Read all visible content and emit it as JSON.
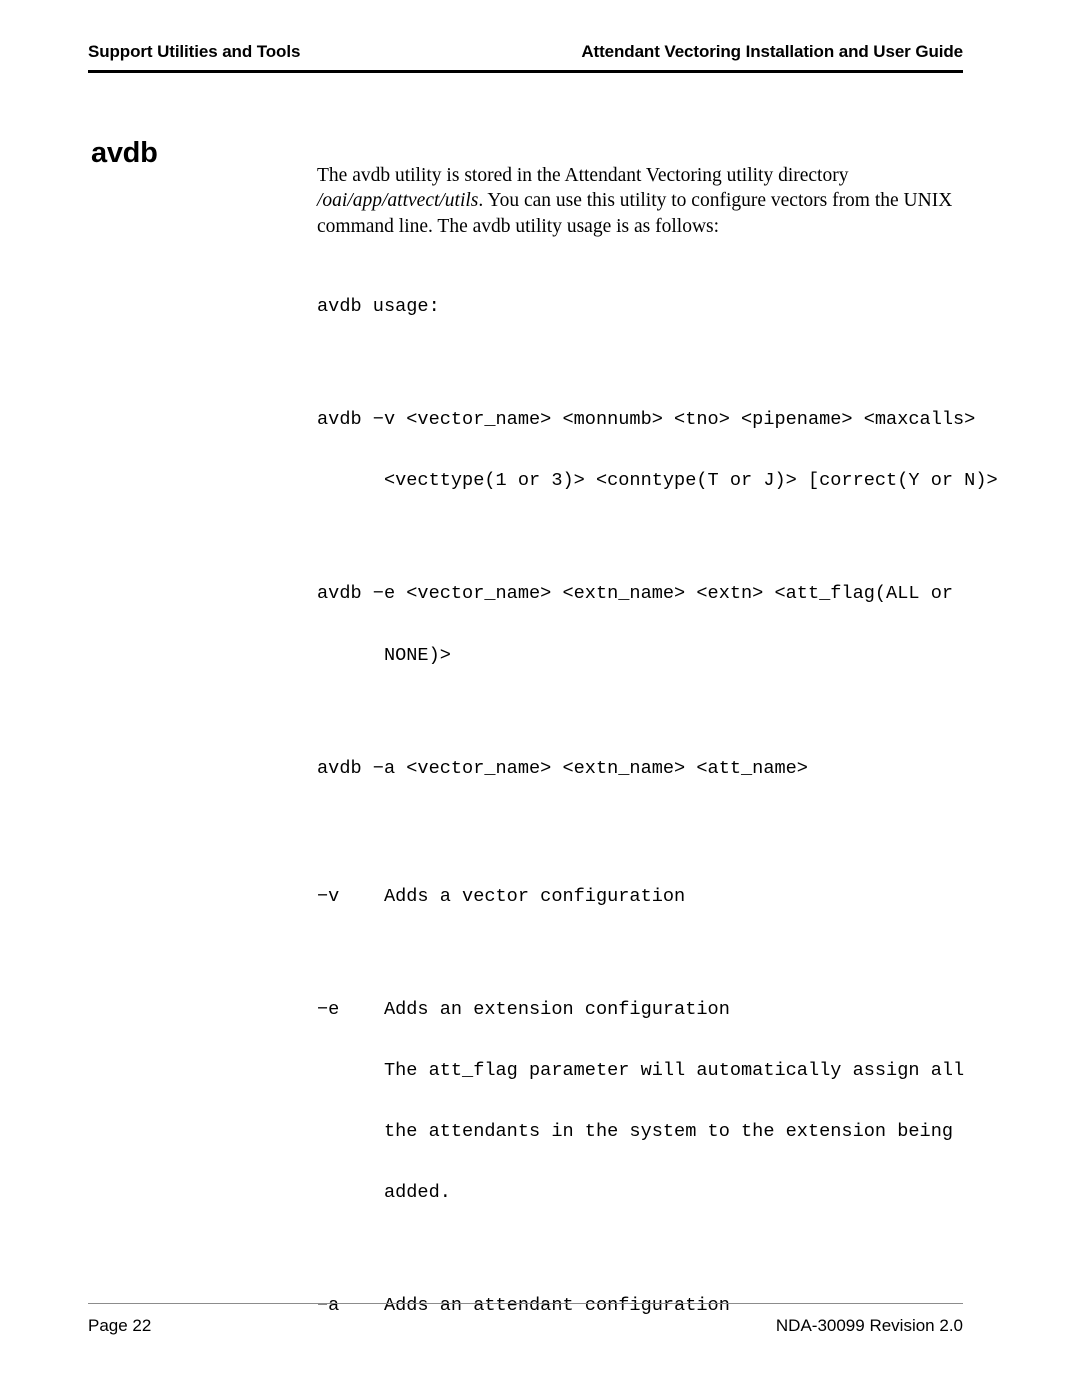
{
  "header": {
    "left_title": "Support Utilities and Tools",
    "right_title": "Attendant Vectoring Installation and User Guide"
  },
  "heading": "avdb",
  "intro": {
    "text_before_path": "The avdb utility is stored in the Attendant Vectoring utility directory ",
    "path": "/oai/app/attvect/utils",
    "text_after_path": ".  You can use this utility to configure vectors from the UNIX command line.  The avdb utility usage is as follows:"
  },
  "usage": {
    "line_usage_label": "avdb usage:",
    "vector_cmd_line1": "avdb −v <vector_name> <monnumb> <tno> <pipename> <maxcalls>",
    "vector_cmd_line2": "      <vecttype(1 or 3)> <conntype(T or J)> [correct(Y or N)>",
    "extn_cmd_line1": "avdb −e <vector_name> <extn_name> <extn> <att_flag(ALL or",
    "extn_cmd_line2": "      NONE)>",
    "att_cmd_line1": "avdb −a <vector_name> <extn_name> <att_name>"
  },
  "flags": {
    "v_flag": "−v    Adds a vector configuration",
    "e_flag": "−e    Adds an extension configuration",
    "e_note_line1": "      The att_flag parameter will automatically assign all",
    "e_note_line2": "      the attendants in the system to the extension being",
    "e_note_line3": "      added.",
    "a_flag": "−a    Adds an attendant configuration"
  },
  "footer": {
    "page_label": "Page 22",
    "doc_ref": "NDA-30099  Revision 2.0"
  },
  "colors": {
    "text": "#000000",
    "header_rule": "#000000",
    "footer_rule": "#8c8c8c",
    "background": "#ffffff"
  }
}
